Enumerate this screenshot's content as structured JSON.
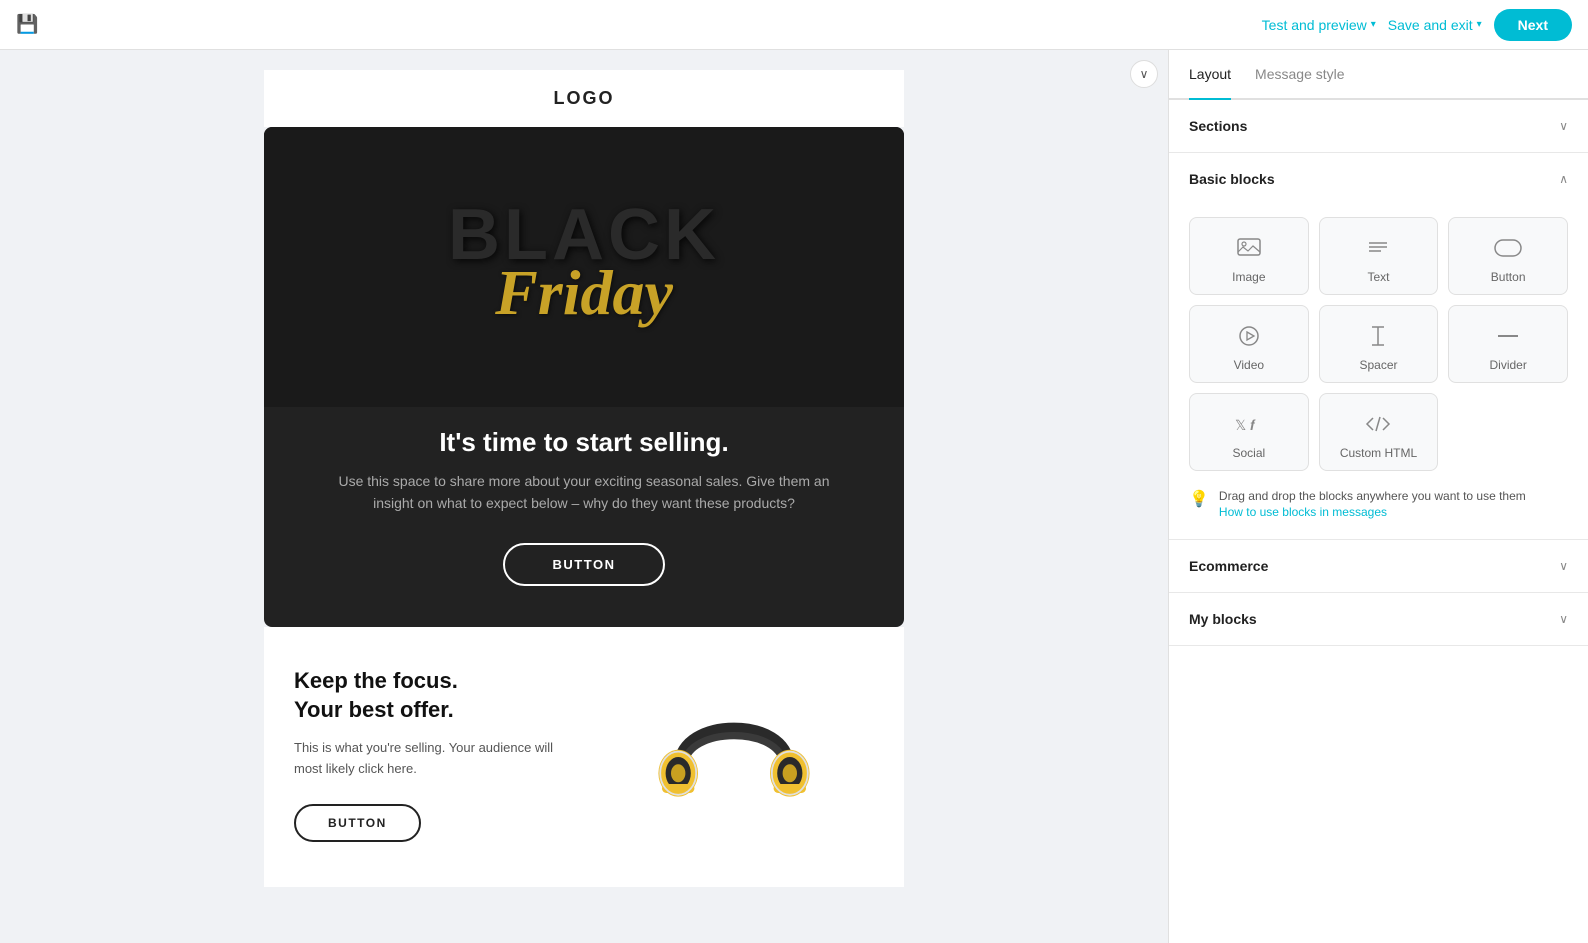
{
  "topbar": {
    "save_icon": "💾",
    "test_preview_label": "Test and preview",
    "test_preview_chevron": "▾",
    "save_exit_label": "Save and exit",
    "save_exit_chevron": "▾",
    "next_label": "Next"
  },
  "canvas": {
    "collapse_icon": "∨",
    "logo_text": "LOGO",
    "hero": {
      "bf_black": "BLACK",
      "bf_friday": "Friday",
      "headline": "It's time to start selling.",
      "subtext": "Use this space to share more about your exciting seasonal sales. Give them an insight on what to expect below – why do they want these products?",
      "button_label": "BUTTON"
    },
    "product": {
      "headline_line1": "Keep the focus.",
      "headline_line2": "Your best offer.",
      "description": "This is what you're selling. Your audience will most likely click here.",
      "button_label": "BUTTON"
    }
  },
  "right_panel": {
    "tabs": [
      {
        "label": "Layout",
        "active": true
      },
      {
        "label": "Message style",
        "active": false
      }
    ],
    "sections": {
      "sections_title": "Sections",
      "basic_blocks_title": "Basic blocks",
      "ecommerce_title": "Ecommerce",
      "my_blocks_title": "My blocks"
    },
    "blocks": [
      {
        "id": "image",
        "label": "Image"
      },
      {
        "id": "text",
        "label": "Text"
      },
      {
        "id": "button",
        "label": "Button"
      },
      {
        "id": "video",
        "label": "Video"
      },
      {
        "id": "spacer",
        "label": "Spacer"
      },
      {
        "id": "divider",
        "label": "Divider"
      },
      {
        "id": "social",
        "label": "Social"
      },
      {
        "id": "custom_html",
        "label": "Custom HTML"
      }
    ],
    "hint_text": "Drag and drop the blocks anywhere you want to use them",
    "hint_link": "How to use blocks in messages"
  }
}
